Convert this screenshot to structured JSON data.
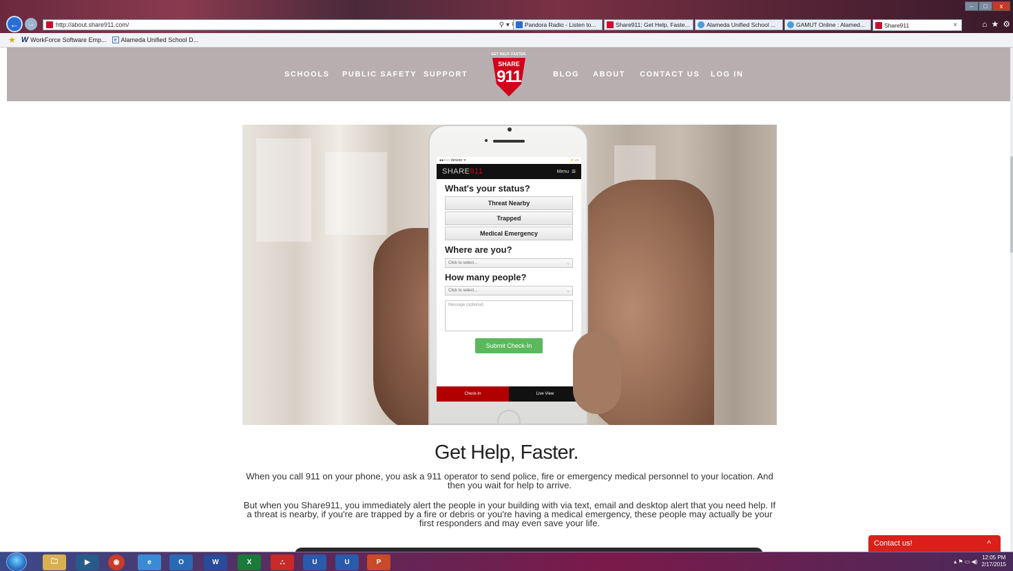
{
  "browser": {
    "address_url": "http://about.share911.com/",
    "address_controls": "⚲ ▾ ↻",
    "tabs": [
      {
        "label": "Pandora Radio - Listen to...",
        "color": "#2a6ad4"
      },
      {
        "label": "Share911: Get Help, Faste...",
        "color": "#c8102e"
      },
      {
        "label": "Alameda Unified School ...",
        "color": "#4a9ae0"
      },
      {
        "label": "GAMUT Online : Alamed...",
        "color": "#4a9ae0"
      },
      {
        "label": "Share911",
        "color": "#c8102e"
      }
    ],
    "tab_close": "×",
    "window_controls": [
      "–",
      "□",
      "x"
    ],
    "icons": [
      "home-icon",
      "star-icon",
      "gear-icon"
    ],
    "favorites": [
      {
        "label": "WorkForce Software Emp...",
        "icon": "workforce-icon"
      },
      {
        "label": "Alameda Unified School D...",
        "icon": "ie-page-icon"
      }
    ]
  },
  "header": {
    "nav_left": [
      "SCHOOLS",
      "PUBLIC SAFETY",
      "SUPPORT"
    ],
    "nav_right": [
      "BLOG",
      "ABOUT",
      "CONTACT US",
      "LOG IN"
    ],
    "logo": {
      "tagline": "GET HELP. FASTER.",
      "share": "SHARE",
      "number": "911"
    },
    "bg_color": "#b7aeb0"
  },
  "phone_screen": {
    "carrier": "●●○○○ Verizon ᯤ",
    "battery": "⚡ ▭",
    "brand_prefix": "SHARE",
    "brand_suffix": "911",
    "menu": "Menu",
    "menu_icon": "≡",
    "status_heading": "What's your status?",
    "status_options": [
      "Threat Nearby",
      "Trapped",
      "Medical Emergency"
    ],
    "location_heading": "Where are you?",
    "location_placeholder": "Click to select...",
    "people_heading": "How many people?",
    "people_placeholder": "Click to select...",
    "message_placeholder": "Message (optional)",
    "submit": "Submit Check-In",
    "tab_checkin": "Check-In",
    "tab_live": "Live View",
    "accent": "#5cb85c"
  },
  "main": {
    "headline": "Get Help, Faster.",
    "paragraph1": "When you call 911 on your phone, you ask a 911 operator to send police, fire or emergency medical personnel to your location. And then you wait for help to arrive.",
    "paragraph2": "But when you Share911, you immediately alert the people in your building with via text, email and desktop alert that you need help. If a threat is nearby, if you're are trapped by a fire or debris or you're having a medical emergency, these people may actually be your first responders and may even save your life."
  },
  "contact_widget": {
    "label": "Contact us!",
    "icon": "^",
    "color": "#d9201a"
  },
  "taskbar": {
    "apps": [
      "explorer-icon",
      "media-player-icon",
      "chrome-icon",
      "ie-icon",
      "outlook-icon",
      "word-icon",
      "excel-icon",
      "acrobat-icon",
      "app-u-icon",
      "app-u2-icon",
      "powerpoint-icon"
    ],
    "app_glyphs": [
      "🗀",
      "▶",
      "◉",
      "e",
      "O",
      "W",
      "X",
      "⛬",
      "U",
      "U",
      "P"
    ],
    "tray_icons": "▴ ⚑ ▭ ◀)",
    "time": "12:05 PM",
    "date": "2/17/2015"
  }
}
